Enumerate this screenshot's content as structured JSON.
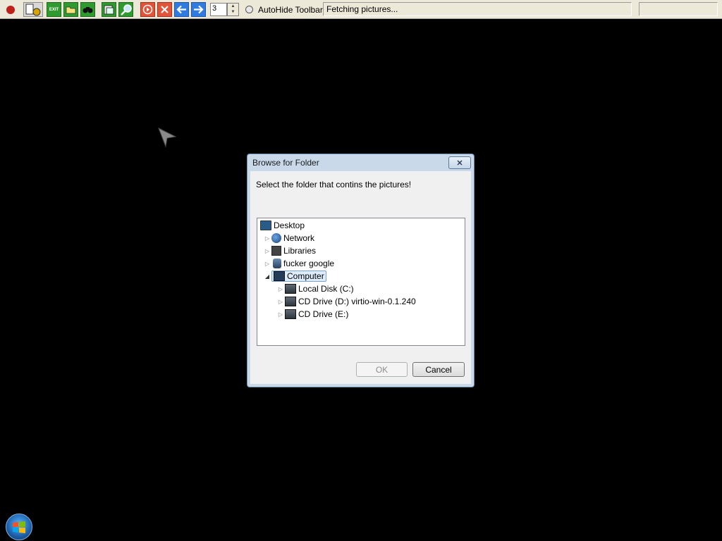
{
  "toolbar": {
    "count_value": "3",
    "autohide_label": "AutoHide Toolbar",
    "status_text": "Fetching pictures...",
    "exit_label": "EXIT"
  },
  "dialog": {
    "title": "Browse for Folder",
    "prompt": "Select the folder that contins the pictures!",
    "tree": [
      {
        "label": "Desktop"
      },
      {
        "label": "Network"
      },
      {
        "label": "Libraries"
      },
      {
        "label": "fucker google"
      },
      {
        "label": "Computer"
      },
      {
        "label": "Local Disk (C:)"
      },
      {
        "label": "CD Drive (D:) virtio-win-0.1.240"
      },
      {
        "label": "CD Drive (E:)"
      }
    ],
    "ok_label": "OK",
    "cancel_label": "Cancel",
    "close_label": "✕"
  },
  "colors": {
    "toolbar_green": "#2f9a2f",
    "toolbar_red": "#e0553a",
    "toolbar_blue": "#2f7be0",
    "selection": "#dcecfc"
  },
  "icons": [
    "stop-icon",
    "settings-icon",
    "exit-icon",
    "open-folder-icon",
    "binoculars-icon",
    "image-icon",
    "zoom-icon",
    "play-icon",
    "close-icon",
    "back-arrow-icon",
    "forward-arrow-icon",
    "cursor-icon",
    "windows-logo-icon"
  ]
}
